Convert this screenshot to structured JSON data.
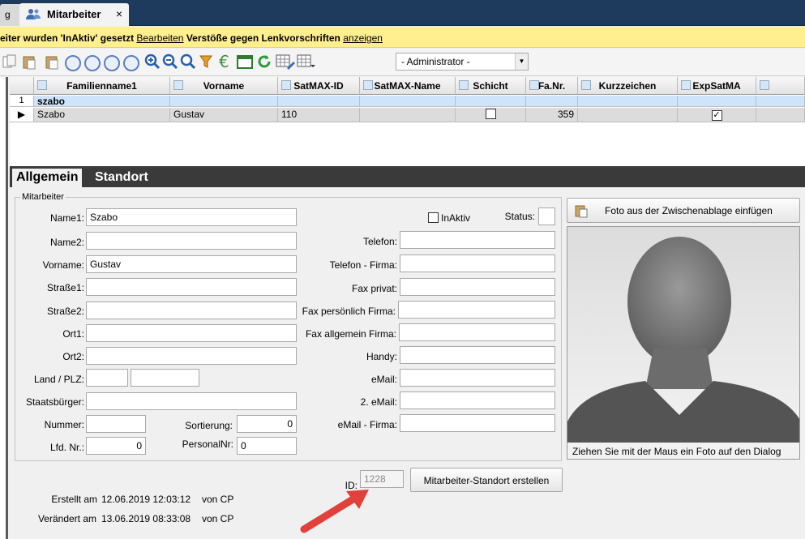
{
  "tabs": {
    "prev_label": "g",
    "active_label": "Mitarbeiter",
    "close_glyph": "×"
  },
  "notice": {
    "text1": "eiter wurden 'InAktiv' gesetzt",
    "link1": "Bearbeiten",
    "text2": "Verstöße gegen Lenkvorschriften",
    "link2": "anzeigen"
  },
  "toolbar": {
    "role_select": "- Administrator -",
    "icons": [
      "copy-icon",
      "paste-icon",
      "first-icon",
      "prev-icon",
      "next-icon",
      "last-icon",
      "zoom-in-icon",
      "zoom-out-icon",
      "zoom-icon",
      "filter-icon",
      "euro-icon",
      "table-icon",
      "refresh-icon",
      "grid-edit-icon"
    ]
  },
  "grid": {
    "columns": [
      "Familienname1",
      "Vorname",
      "SatMAX-ID",
      "SatMAX-Name",
      "Schicht",
      "Fa.Nr.",
      "Kurzzeichen",
      "ExpSatMA"
    ],
    "filter_row": {
      "num": "1",
      "Familienname1": "szabo"
    },
    "rows": [
      {
        "Familienname1": "Szabo",
        "Vorname": "Gustav",
        "SatMAX-ID": "110",
        "SatMAX-Name": "",
        "Schicht": false,
        "Fa.Nr.": "359",
        "Kurzzeichen": "",
        "ExpSatMA": true
      }
    ]
  },
  "panel_tabs": [
    "Allgemein",
    "Standort"
  ],
  "form": {
    "group_title": "Mitarbeiter",
    "labels": {
      "name1": "Name1:",
      "name2": "Name2:",
      "vorname": "Vorname:",
      "strasse1": "Straße1:",
      "strasse2": "Straße2:",
      "ort1": "Ort1:",
      "ort2": "Ort2:",
      "land_plz": "Land / PLZ:",
      "staatsbuerger": "Staatsbürger:",
      "nummer": "Nummer:",
      "sortierung": "Sortierung:",
      "lfd_nr": "Lfd. Nr.:",
      "personal_nr": "PersonalNr:",
      "inaktiv": "InAktiv",
      "status": "Status:",
      "telefon": "Telefon:",
      "telefon_firma": "Telefon - Firma:",
      "fax_privat": "Fax privat:",
      "fax_persoenlich": "Fax persönlich Firma:",
      "fax_allgemein": "Fax allgemein Firma:",
      "handy": "Handy:",
      "email": "eMail:",
      "email2": "2. eMail:",
      "email_firma": "eMail - Firma:",
      "id": "ID:"
    },
    "values": {
      "name1": "Szabo",
      "name2": "",
      "vorname": "Gustav",
      "strasse1": "",
      "strasse2": "",
      "ort1": "",
      "ort2": "",
      "land": "",
      "plz": "",
      "staatsbuerger": "",
      "nummer": "",
      "sortierung": "0",
      "lfd_nr": "0",
      "personal_nr": "0",
      "status": "",
      "telefon": "",
      "telefon_firma": "",
      "fax_privat": "",
      "fax_persoenlich": "",
      "fax_allgemein": "",
      "handy": "",
      "email": "",
      "email2": "",
      "email_firma": "",
      "id": "1228"
    },
    "create_location_button": "Mitarbeiter-Standort erstellen",
    "created_label": "Erstellt am",
    "created_value": "12.06.2019 12:03:12",
    "created_by": "von CP",
    "changed_label": "Verändert am",
    "changed_value": "13.06.2019 08:33:08",
    "changed_by": "von CP"
  },
  "photo": {
    "paste_button": "Foto aus der Zwischenablage einfügen",
    "hint": "Ziehen Sie mit der Maus ein Foto auf den Dialog"
  },
  "colors": {
    "tabstrip": "#1e3a5c",
    "notice": "#ffef8f",
    "panel_head": "#3a3a3a",
    "arrow": "#e0413a"
  }
}
